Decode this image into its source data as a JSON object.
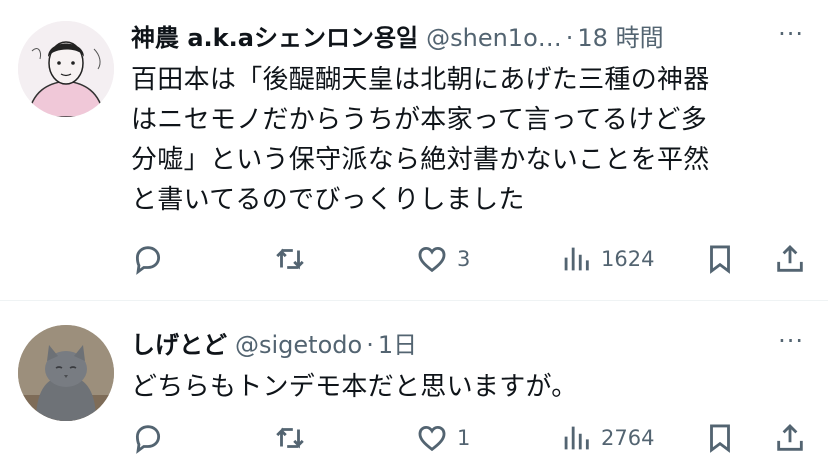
{
  "tweets": [
    {
      "author_name": "神農 a.k.aシェンロン용일",
      "handle": "@shen1o…",
      "separator": "·",
      "time": "18 時間",
      "more": "···",
      "text_lines": [
        "百田本は「後醍醐天皇は北朝にあげた三種の神器",
        "はニセモノだからうちが本家って言ってるけど多",
        "分嘘」という保守派なら絶対書かないことを平然",
        "と書いてるのでびっくりしました"
      ],
      "replies": "",
      "retweets": "",
      "likes": "3",
      "views": "1624",
      "avatar_icon": "person-sketch-avatar"
    },
    {
      "author_name": "しげとど",
      "handle": "@sigetodo",
      "separator": "·",
      "time": "1日",
      "more": "···",
      "text_lines": [
        "どちらもトンデモ本だと思いますが。"
      ],
      "replies": "",
      "retweets": "",
      "likes": "1",
      "views": "2764",
      "avatar_icon": "gray-cat-avatar"
    }
  ]
}
